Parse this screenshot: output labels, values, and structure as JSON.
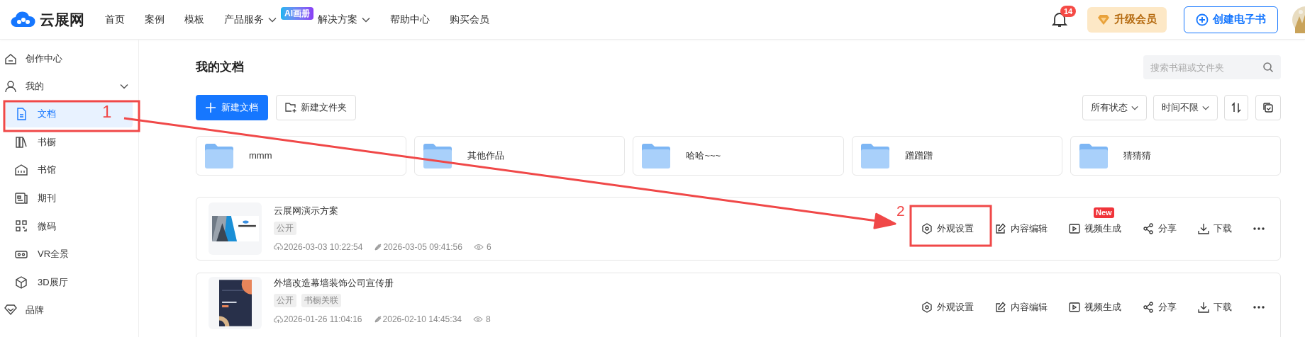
{
  "header": {
    "logo": "云展网",
    "nav": [
      {
        "label": "首页",
        "dropdown": false
      },
      {
        "label": "案例",
        "dropdown": false
      },
      {
        "label": "模板",
        "dropdown": false
      },
      {
        "label": "产品服务",
        "dropdown": true,
        "badge": "AI画册"
      },
      {
        "label": "解决方案",
        "dropdown": true
      },
      {
        "label": "帮助中心",
        "dropdown": false
      },
      {
        "label": "购买会员",
        "dropdown": false
      }
    ],
    "notifications": "14",
    "upgrade_button": "升级会员",
    "create_button": "创建电子书"
  },
  "sidebar": {
    "items": [
      {
        "label": "创作中心",
        "selected": false
      },
      {
        "label": "我的",
        "selected": false,
        "expanded": true,
        "children": [
          {
            "label": "文档",
            "selected": true
          },
          {
            "label": "书橱",
            "selected": false
          },
          {
            "label": "书馆",
            "selected": false
          },
          {
            "label": "期刊",
            "selected": false
          },
          {
            "label": "微码",
            "selected": false
          },
          {
            "label": "VR全景",
            "selected": false
          },
          {
            "label": "3D展厅",
            "selected": false
          }
        ]
      },
      {
        "label": "品牌",
        "selected": false
      }
    ]
  },
  "main": {
    "title": "我的文档",
    "search": {
      "placeholder": "搜索书籍或文件夹"
    },
    "new_document": "新建文档",
    "new_folder": "新建文件夹",
    "filters": [
      "所有状态",
      "时间不限"
    ],
    "folders": [
      "mmm",
      "其他作品",
      "哈哈~~~",
      "蹭蹭蹭",
      "猜猜猜"
    ],
    "documents": [
      {
        "title": "云展网演示方案",
        "tags": [
          "公开"
        ],
        "created": "2026-03-03 10:22:54",
        "modified": "2026-03-05 09:41:56",
        "views": "6",
        "thumbnail": {
          "kind": "picture"
        },
        "actions": [
          {
            "label": "外观设置"
          },
          {
            "label": "内容编辑"
          },
          {
            "label": "视频生成",
            "badge": "New"
          },
          {
            "label": "分享"
          },
          {
            "label": "下载"
          }
        ]
      },
      {
        "title": "外墙改造幕墙装饰公司宣传册",
        "tags": [
          "公开",
          "书橱关联"
        ],
        "created": "2026-01-26 11:04:16",
        "modified": "2026-02-10 14:45:34",
        "views": "8",
        "thumbnail": {
          "kind": "picture"
        },
        "actions": [
          {
            "label": "外观设置"
          },
          {
            "label": "内容编辑"
          },
          {
            "label": "视频生成"
          },
          {
            "label": "分享"
          },
          {
            "label": "下载"
          }
        ]
      }
    ]
  },
  "annotations": [
    {
      "label": "1"
    },
    {
      "label": "2"
    }
  ]
}
